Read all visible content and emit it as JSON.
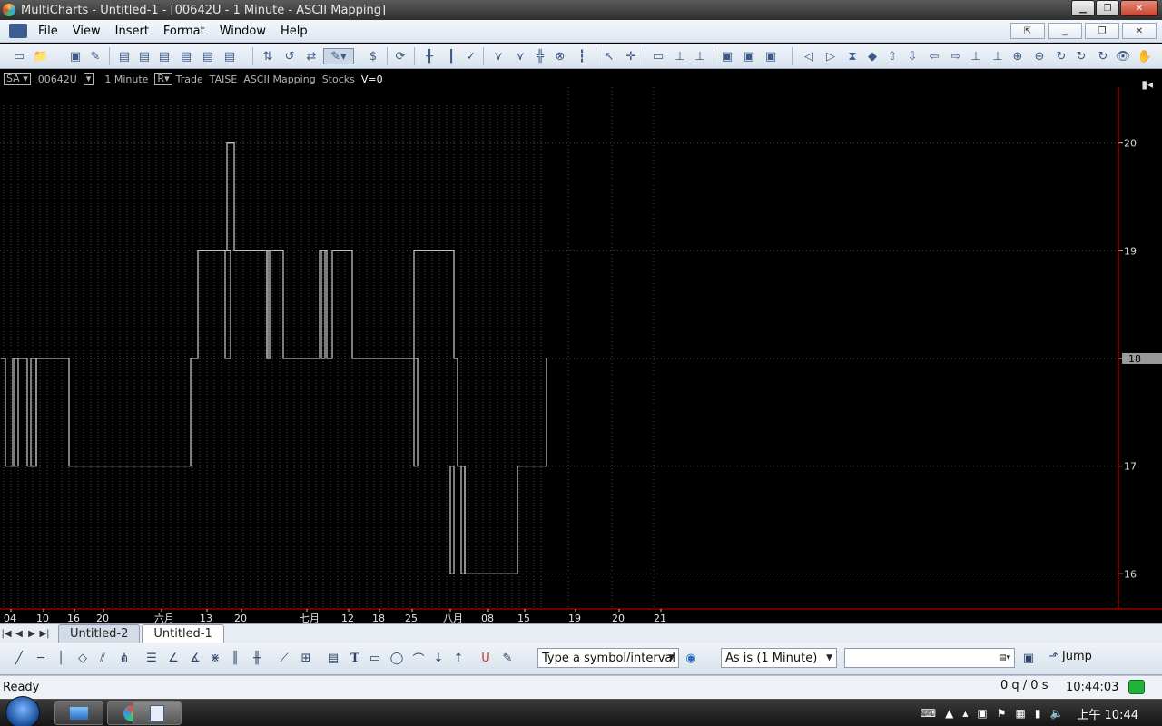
{
  "window": {
    "title": "MultiCharts - Untitled-1 - [00642U - 1 Minute - ASCII Mapping]"
  },
  "menu": {
    "items": [
      "File",
      "View",
      "Insert",
      "Format",
      "Window",
      "Help"
    ]
  },
  "chart_status": {
    "mode": "SA",
    "symbol": "00642U",
    "interval": "1 Minute",
    "r_label": "R",
    "data_type": "Trade",
    "exchange": "TAISE",
    "source": "ASCII Mapping",
    "category": "Stocks",
    "volume": "V=0"
  },
  "colors": {
    "price_line": "#c0c0c0",
    "grid": "#4a4a4a",
    "axis": "#e00000",
    "background": "#000000",
    "last_price_marker": "#9a9a9a"
  },
  "chart_data": {
    "type": "line",
    "ylim": [
      15.8,
      20.25
    ],
    "y_ticks": [
      20,
      19,
      18,
      17,
      16
    ],
    "last_price": "18",
    "x_tick_labels": [
      "04",
      "10",
      "16",
      "20",
      "六月",
      "13",
      "20",
      "七月",
      "12",
      "18",
      "25",
      "八月",
      "08",
      "15",
      "19",
      "20",
      "21"
    ],
    "series": [
      {
        "values": [
          18,
          17,
          18,
          17,
          18,
          17,
          18,
          19,
          20,
          19,
          18,
          19,
          18,
          19,
          18,
          19,
          18,
          19,
          18,
          17,
          16,
          17,
          18
        ]
      }
    ]
  },
  "tabs": {
    "items": [
      "Untitled-2",
      "Untitled-1"
    ],
    "active": "Untitled-1"
  },
  "drawbar": {
    "symbol_placeholder": "Type a symbol/interval",
    "resolution_value": "As is (1 Minute)",
    "jump_label": "Jump"
  },
  "status": {
    "text": "Ready",
    "queue": "0 q / 0 s",
    "time": "10:44:03"
  },
  "taskbar": {
    "clock": "上午 10:44"
  }
}
